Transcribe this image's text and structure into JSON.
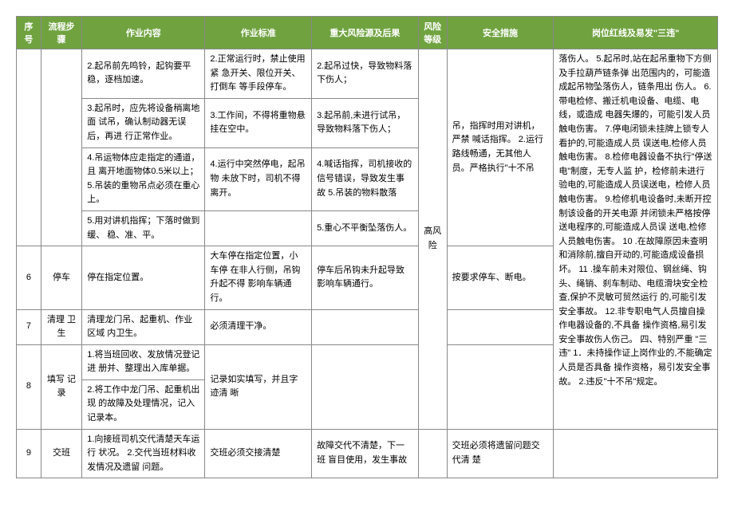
{
  "headers": {
    "seq": "序号",
    "step": "流程步骤",
    "content": "作业内容",
    "standard": "作业标准",
    "risk": "重大风险源及后果",
    "level": "风险等级",
    "measure": "安全措施",
    "redline": "岗位红线及易发\"三违\""
  },
  "r1": {
    "content": "2.起吊前先鸣铃，起钩要平稳，逐档加速。",
    "standard": "2.正常运行时，禁止使用紧 急开关、限位开关、打倒车 等手段停车。",
    "risk": "2.起吊过快，导致物料落 下伤人；"
  },
  "r2": {
    "content": "3.起吊时，应先将设备稍离地面 试吊，确认制动器无误后，再进 行正常作业。",
    "standard": "3.工作间，不得将重物悬 挂在空中。",
    "risk": "3.起吊前,未进行试吊，导致物料落下伤人；"
  },
  "r3": {
    "content": "4.吊运物体应走指定的通道，且 离开地面物体0.5米以上；\n5.吊装的重物吊点必须在重心 上。",
    "standard": "4.运行中突然停电，起吊物 未放下时，司机不得离开。",
    "risk": "4.喊话指挥，司机接收的 信号错误，导致发生事故\n5.吊装的物料散落"
  },
  "r4": {
    "content": "5.用对讲机指挥；下落时做到缓、 稳、准、平。",
    "standard": "",
    "risk": "5.重心不平衡坠落伤人。"
  },
  "m1": "吊，指挥时用对讲机，严禁 喊话指挥。\n2.运行路线畅通，无其他人 员。严格执行\"十不吊",
  "row6": {
    "seq": "6",
    "step": "停车",
    "content": "停在指定位置。",
    "standard": "大车停在指定位置，小车停 在非人行侧，吊钩升起不得 影响车辆通行。",
    "risk": "停车后吊钩未升起导致 影响车辆通行。",
    "measure": "按要求停车、断电。"
  },
  "row7": {
    "seq": "7",
    "step": "清理 卫生",
    "content": "清理龙门吊、起重机、作业区域 内卫生。",
    "standard": "必须清理干净。",
    "risk": "",
    "measure": ""
  },
  "row8": {
    "seq": "8",
    "step": "填写 记录",
    "c1": "1.将当班回收、发放情况登记进 册并、整理出入库单据。",
    "c2": "2.将工作中龙门吊、起重机出现 的故障及处理情况，记入记录本。",
    "standard": "记录如实填写，并且字迹清 晰",
    "risk": "",
    "measure": ""
  },
  "row9": {
    "seq": "9",
    "step": "交班",
    "content": "1.向接班司机交代清楚天车运行 状况。\n2.交代当班材料收发情况及遗留 问题。",
    "standard": "交班必须交接清楚",
    "risk": "故障交代不清楚，下一班 盲目使用，发生事故",
    "measure": "交班必须将遗留问题交代清 楚"
  },
  "level": "高风险",
  "redline": "落伤人。\n5.起吊时,站在起吊重物下方侧及手拉葫芦链条弹 出范围内的，可能造成起吊物坠落伤人，链条甩出 伤人。\n6.带电检修、搬迁机电设备、电缆、电线，或造成 电器失爆的，可能引发人员触电伤害。\n7.停电闭锁未挂牌上锁专人看护的,可能造成人员 误送电,检修人员触电伤害。\n8.检修电器设备不执行\"停送电\"制度，无专人监 护，检修前未进行验电的,可能造成人员误送电，检修人员触电伤害。\n9.检修机电设备时,未断开控制该设备的开关电源 并闭锁未严格按停送电程序的,可能造成人员误 送电,检修人员触电伤害。\n10 .在故障原因未查明和消除前,擅自开动的,可能造成设备损坏。\n11 .操车前未对限位、钢丝绳、钩头、绳销、刹车制动、电缆滑块安全检查,保护不灵敏可贸然运行 的,可能引发安全事故。\n12.非专职电气人员擅自操作电器设备的,不具备 操作资格,易引发安全事故伤人伤己。\n四、特别严重 \"三违\"\n1．未持操作证上岗作业的,不能确定人员是否具备 操作资格，易引发安全事故。\n2.违反\"十不吊\"规定。"
}
